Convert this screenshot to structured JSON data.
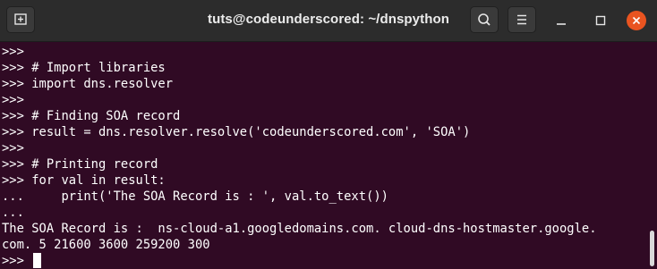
{
  "window": {
    "title": "tuts@codeunderscored: ~/dnspython"
  },
  "header_buttons": {
    "new_tab_icon": "new-tab-icon",
    "search_icon": "search-icon",
    "menu_icon": "hamburger-menu-icon",
    "minimize_icon": "minimize-icon",
    "maximize_icon": "maximize-icon",
    "close_icon": "close-icon"
  },
  "terminal": {
    "lines": [
      ">>>",
      ">>> # Import libraries",
      ">>> import dns.resolver",
      ">>>",
      ">>> # Finding SOA record",
      ">>> result = dns.resolver.resolve('codeunderscored.com', 'SOA')",
      ">>>",
      ">>> # Printing record",
      ">>> for val in result:",
      "...     print('The SOA Record is : ', val.to_text())",
      "...",
      "The SOA Record is :  ns-cloud-a1.googledomains.com. cloud-dns-hostmaster.google.",
      "com. 5 21600 3600 259200 300",
      ">>> "
    ]
  },
  "colors": {
    "terminal_bg": "#300a24",
    "titlebar_bg": "#2c2c2c",
    "close_button": "#e95420",
    "text": "#ffffff"
  }
}
